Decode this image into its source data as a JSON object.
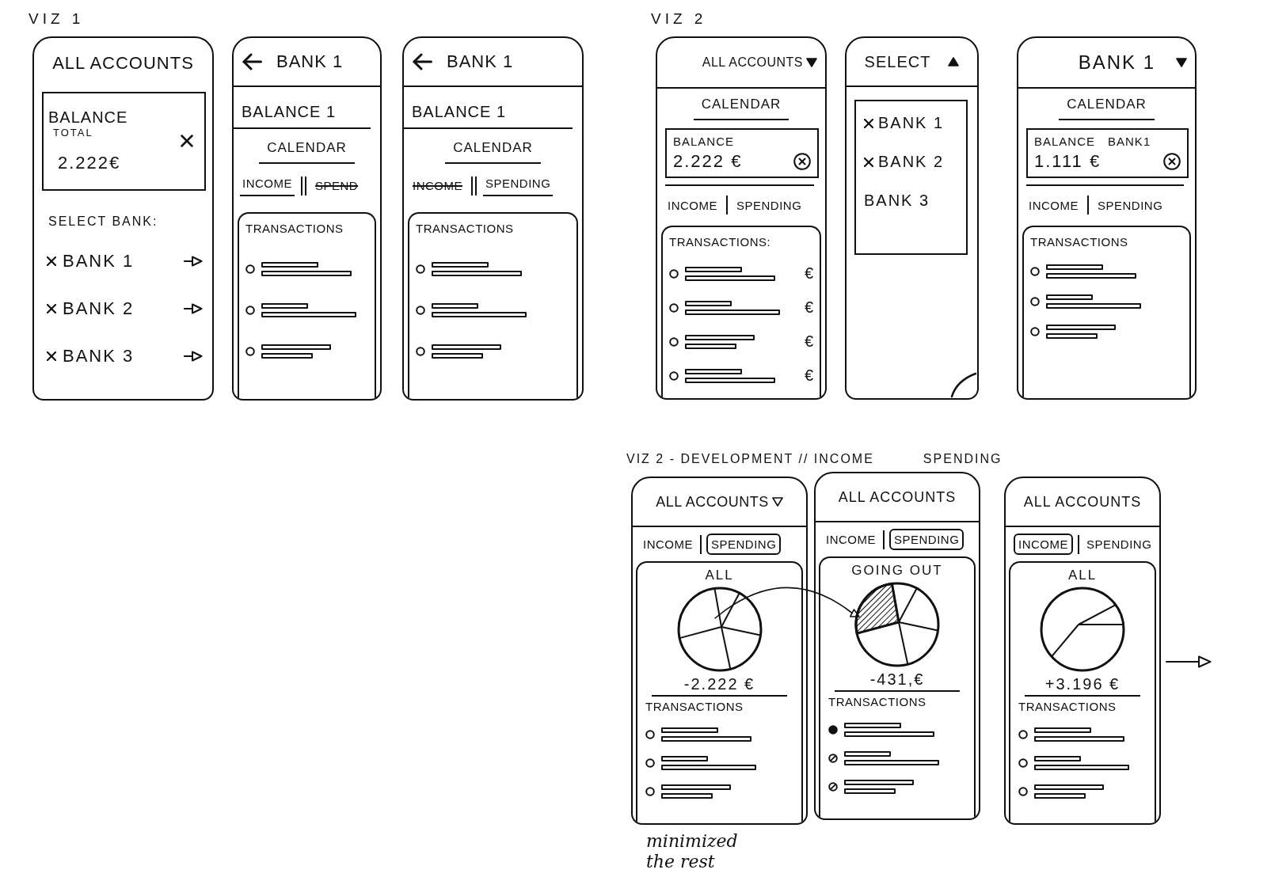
{
  "viz_1": {
    "title": "VIZ 1",
    "screens": [
      {
        "kind": "accounts",
        "header": {
          "title": "ALL ACCOUNTS"
        },
        "balance": {
          "label": "BALANCE",
          "sublabel": "TOTAL",
          "amount": "2.222€"
        },
        "select_label": "SELECT BANK:",
        "banks": [
          {
            "name": "BANK 1",
            "checked": true
          },
          {
            "name": "BANK 2",
            "checked": true
          },
          {
            "name": "BANK 3",
            "checked": true
          }
        ]
      },
      {
        "kind": "bank",
        "header": {
          "title": "BANK 1",
          "back": true
        },
        "balance_title": "BALANCE 1",
        "calendar": "CALENDAR",
        "tabs": {
          "kind": "underline",
          "items": [
            {
              "label": "INCOME",
              "selected": true
            },
            {
              "label": "SPEND",
              "selected": false
            }
          ]
        },
        "transactions": {
          "title": "TRANSACTIONS",
          "rows": [
            {
              "kind": "open"
            },
            {
              "kind": "open"
            },
            {
              "kind": "open"
            }
          ]
        }
      },
      {
        "kind": "bank",
        "header": {
          "title": "BANK 1",
          "back": true
        },
        "balance_title": "BALANCE 1",
        "calendar": "CALENDAR",
        "tabs": {
          "kind": "underline",
          "items": [
            {
              "label": "INCOME",
              "selected": false
            },
            {
              "label": "SPENDING",
              "selected": true
            }
          ]
        },
        "transactions": {
          "title": "TRANSACTIONS",
          "rows": [
            {
              "kind": "open"
            },
            {
              "kind": "open"
            },
            {
              "kind": "open"
            }
          ]
        }
      }
    ]
  },
  "viz_2": {
    "title": "VIZ 2",
    "screens": [
      {
        "kind": "dashboard",
        "header": {
          "title": "ALL ACCOUNTS",
          "dropdown": {
            "expanded": false
          }
        },
        "calendar": "CALENDAR",
        "balance": {
          "label": "BALANCE",
          "amount": "2.222 €"
        },
        "tabs": {
          "items": [
            {
              "label": "INCOME"
            },
            {
              "label": "SPENDING"
            }
          ]
        },
        "transactions": {
          "title": "TRANSACTIONS:",
          "rows": [
            {
              "kind": "open",
              "amount": "€"
            },
            {
              "kind": "open",
              "amount": "€"
            },
            {
              "kind": "open",
              "amount": "€"
            },
            {
              "kind": "open",
              "amount": "€"
            }
          ]
        }
      },
      {
        "kind": "dropdown",
        "header": {
          "title": "SELECT",
          "dropdown": {
            "expanded": true
          }
        },
        "options": [
          {
            "name": "BANK 1",
            "checked": true
          },
          {
            "name": "BANK 2",
            "checked": true
          },
          {
            "name": "BANK 3",
            "checked": false
          }
        ]
      },
      {
        "kind": "dashboard",
        "header": {
          "title": "BANK 1",
          "dropdown": {
            "expanded": false
          }
        },
        "calendar": "CALENDAR",
        "balance": {
          "label": "BALANCE",
          "sublabel": "BANK1",
          "amount": "1.111 €"
        },
        "tabs": {
          "items": [
            {
              "label": "INCOME"
            },
            {
              "label": "SPENDING"
            }
          ]
        },
        "transactions": {
          "title": "TRANSACTIONS",
          "rows": [
            {
              "kind": "open"
            },
            {
              "kind": "open"
            },
            {
              "kind": "open"
            }
          ]
        }
      }
    ]
  },
  "viz_2_development": {
    "title": "VIZ 2 - DEVELOPMENT // INCOME",
    "title_2": "SPENDING",
    "screens": [
      {
        "kind": "chart",
        "header": {
          "title": "ALL ACCOUNTS",
          "dropdown": {
            "expanded": false
          }
        },
        "tabs": {
          "kind": "boxed",
          "items": [
            {
              "label": "INCOME",
              "selected": false
            },
            {
              "label": "SPENDING",
              "selected": true
            }
          ]
        },
        "chart": {
          "title": "ALL",
          "kind": "spending",
          "highlighted": false
        },
        "total": "-2.222 €",
        "transactions": {
          "title": "TRANSACTIONS",
          "rows": [
            {
              "kind": "open"
            },
            {
              "kind": "open"
            },
            {
              "kind": "open"
            }
          ]
        }
      },
      {
        "kind": "chart",
        "header": {
          "title": "ALL ACCOUNTS"
        },
        "tabs": {
          "kind": "boxed",
          "items": [
            {
              "label": "INCOME",
              "selected": false
            },
            {
              "label": "SPENDING",
              "selected": true
            }
          ]
        },
        "chart": {
          "title": "GOING OUT",
          "kind": "spending",
          "highlighted": true
        },
        "total": "-431,€",
        "transactions": {
          "title": "TRANSACTIONS",
          "rows": [
            {
              "kind": "filled"
            },
            {
              "kind": "hatched"
            },
            {
              "kind": "hatched"
            }
          ]
        }
      },
      {
        "kind": "chart",
        "header": {
          "title": "ALL ACCOUNTS"
        },
        "tabs": {
          "kind": "boxed",
          "items": [
            {
              "label": "INCOME",
              "selected": true
            },
            {
              "label": "SPENDING",
              "selected": false
            }
          ]
        },
        "chart": {
          "title": "ALL",
          "kind": "income",
          "highlighted": false
        },
        "total": "+3.196 €",
        "transactions": {
          "title": "TRANSACTIONS",
          "rows": [
            {
              "kind": "open"
            },
            {
              "kind": "open"
            },
            {
              "kind": "open"
            }
          ]
        }
      }
    ],
    "note": "minimized the rest"
  }
}
